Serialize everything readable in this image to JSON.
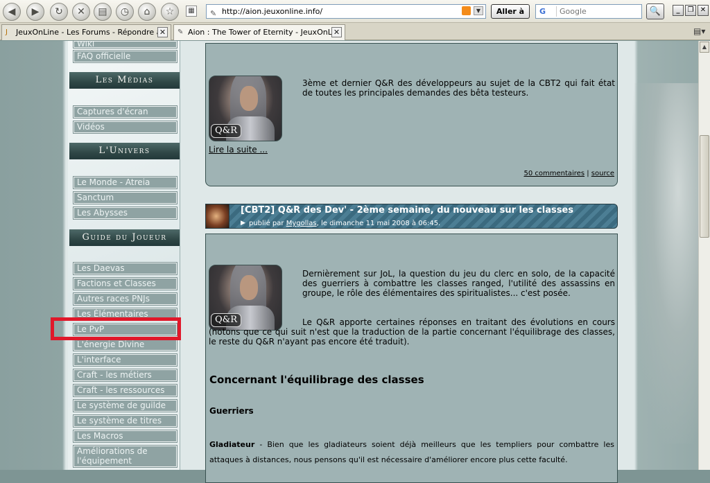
{
  "browser": {
    "address": "http://aion.jeuxonline.info/",
    "go_label": "Aller à",
    "search_engine": "G",
    "search_placeholder": "Google",
    "nav_icons": [
      "back-icon",
      "forward-icon",
      "reload-icon",
      "stop-icon",
      "print-icon",
      "history-icon",
      "home-icon",
      "bookmark-star-icon"
    ],
    "tabs": [
      {
        "label": "JeuxOnLine - Les Forums - Répondre a...",
        "active": false
      },
      {
        "label": "Aion : The Tower of Eternity - JeuxOnLi...",
        "active": true
      }
    ],
    "window_buttons": [
      "_",
      "❐",
      "✕"
    ]
  },
  "sidebar": {
    "top_items": [
      {
        "label": "Wiki"
      },
      {
        "label": "FAQ officielle"
      }
    ],
    "sections": [
      {
        "title": "Les Médias",
        "items": [
          {
            "label": "Captures d'écran"
          },
          {
            "label": "Vidéos"
          }
        ]
      },
      {
        "title": "L'Univers",
        "items": [
          {
            "label": "Le Monde - Atreia"
          },
          {
            "label": "Sanctum"
          },
          {
            "label": "Les Abysses"
          }
        ]
      },
      {
        "title": "Guide du Joueur",
        "items": [
          {
            "label": "Les Daevas"
          },
          {
            "label": "Factions et Classes"
          },
          {
            "label": "Autres races PNJs"
          },
          {
            "label": "Les Élémentaires"
          },
          {
            "label": "Le PvP"
          },
          {
            "label": "L'énergie Divine"
          },
          {
            "label": "L'interface"
          },
          {
            "label": "Craft - les métiers"
          },
          {
            "label": "Craft - les ressources"
          },
          {
            "label": "Le système de guilde"
          },
          {
            "label": "Le système de titres"
          },
          {
            "label": "Les Macros"
          },
          {
            "label": "Améliorations de l'équipement"
          }
        ]
      }
    ],
    "highlighted_item": "Le PvP"
  },
  "article1": {
    "thumb_badge": "Q&R",
    "text": "3ème et dernier Q&R des développeurs au sujet de la CBT2 qui fait état de toutes les principales demandes des bêta testeurs.",
    "read_more": "Lire la suite ...",
    "comments": "50 commentaires",
    "separator": "|",
    "source": "source"
  },
  "article2": {
    "title": "[CBT2] Q&R des Dev' - 2ème semaine, du nouveau sur les classes",
    "meta_prefix": "publié par",
    "author": "Mygollas",
    "meta_suffix": ", le dimanche 11 mai 2008 à 06:45.",
    "thumb_badge": "Q&R",
    "para1": "Dernièrement sur JoL, la question du jeu du clerc en solo, de la capacité des guerriers à combattre les classes ranged, l'utilité des assassins en groupe, le rôle des élémentaires des spiritualistes... c'est posée.",
    "para2": "Le Q&R apporte certaines réponses en traitant des évolutions en cours (notons que ce qui suit n'est que la traduction de la partie concernant l'équilibrage des classes, le reste du Q&R n'ayant pas encore été traduit).",
    "section_heading": "Concernant l'équilibrage des classes",
    "subheading": "Guerriers",
    "gladiator_label": "Gladiateur",
    "gladiator_text": " - Bien que les gladiateurs soient déjà meilleurs que les templiers pour combattre les attaques à distances, nous pensons qu'il est nécessaire d'améliorer encore plus cette faculté."
  },
  "colors": {
    "highlight": "#e0182a",
    "sidebar_link_bg": "#8fa3a3",
    "header_bg": "#2f4746",
    "card_bg": "#9fb3b4"
  }
}
